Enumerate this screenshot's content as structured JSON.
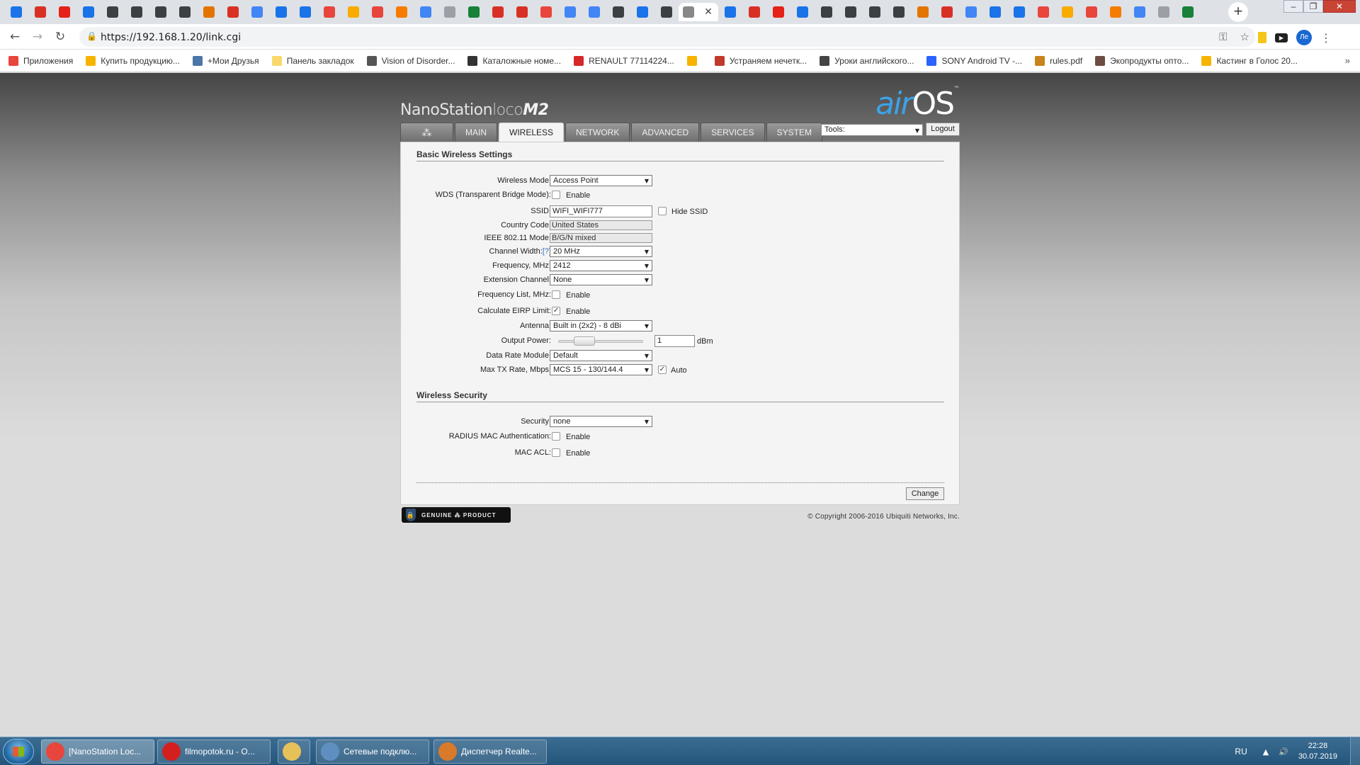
{
  "browser": {
    "url": "https://192.168.1.20/link.cgi",
    "new_tab": "+",
    "close_tab": "✕",
    "avatar": "Ле",
    "window_controls": [
      "–",
      "❐",
      "✕"
    ]
  },
  "bookmarks": [
    {
      "label": "Приложения",
      "color": "#e8453c"
    },
    {
      "label": "Купить продукцию...",
      "color": "#f6b400"
    },
    {
      "label": "+Мои Друзья",
      "color": "#4a76a8"
    },
    {
      "label": "Панель закладок",
      "color": "#f9d86b"
    },
    {
      "label": "Vision of Disorder...",
      "color": "#555555"
    },
    {
      "label": "Каталожные номе...",
      "color": "#333333"
    },
    {
      "label": "RENAULT 77114224...",
      "color": "#d62828"
    },
    {
      "label": "",
      "color": "#f6b400"
    },
    {
      "label": "Устраняем нечетк...",
      "color": "#c0392b"
    },
    {
      "label": "Уроки английского...",
      "color": "#444444"
    },
    {
      "label": "SONY Android TV -...",
      "color": "#2962ff"
    },
    {
      "label": "rules.pdf",
      "color": "#c8831a"
    },
    {
      "label": "Экопродукты опто...",
      "color": "#6d4c41"
    },
    {
      "label": "Кастинг в Голос 20...",
      "color": "#f6b400"
    }
  ],
  "airos": {
    "brand_main": "NanoStation",
    "brand_loco": "loco",
    "brand_model": "M2",
    "logo_air": "air",
    "logo_os": "OS",
    "logo_tm": "™",
    "tabs": {
      "logo": "⁂",
      "main": "MAIN",
      "wireless": "WIRELESS",
      "network": "NETWORK",
      "advanced": "ADVANCED",
      "services": "SERVICES",
      "system": "SYSTEM"
    },
    "tools": "Tools:",
    "logout": "Logout",
    "basic_title": "Basic Wireless Settings",
    "security_title": "Wireless Security",
    "enable": "Enable",
    "fields": {
      "wireless_mode": {
        "label": "Wireless Mode:",
        "value": "Access Point"
      },
      "wds": {
        "label": "WDS (Transparent Bridge Mode):"
      },
      "ssid": {
        "label": "SSID:",
        "value": "WIFI_WIFI777",
        "hide": "Hide SSID"
      },
      "country": {
        "label": "Country Code:",
        "value": "United States"
      },
      "ieee": {
        "label": "IEEE 802.11 Mode:",
        "value": "B/G/N mixed"
      },
      "channel_width": {
        "label": "Channel Width:",
        "help": "[?]",
        "value": "20 MHz"
      },
      "frequency": {
        "label": "Frequency, MHz:",
        "value": "2412"
      },
      "extension": {
        "label": "Extension Channel:",
        "value": "None"
      },
      "freq_list": {
        "label": "Frequency List, MHz:"
      },
      "eirp": {
        "label": "Calculate EIRP Limit:"
      },
      "antenna": {
        "label": "Antenna:",
        "value": "Built in (2x2) - 8 dBi"
      },
      "output_power": {
        "label": "Output Power:",
        "value": "1",
        "unit": "dBm"
      },
      "data_rate": {
        "label": "Data Rate Module:",
        "value": "Default"
      },
      "max_tx": {
        "label": "Max TX Rate, Mbps:",
        "value": "MCS 15 - 130/144.4",
        "auto": "Auto"
      },
      "security": {
        "label": "Security:",
        "value": "none"
      },
      "radius": {
        "label": "RADIUS MAC Authentication:"
      },
      "mac_acl": {
        "label": "MAC ACL:"
      }
    },
    "check": "✓",
    "change": "Change",
    "genuine": "GENUINE ⁂ PRODUCT",
    "genuine_lock": "🔒",
    "copyright": "© Copyright 2006-2016 Ubiquiti Networks, Inc."
  },
  "taskbar": {
    "items": [
      {
        "label": "[NanoStation Loc...",
        "color": "#e8453c"
      },
      {
        "label": "filmopotok.ru - O...",
        "color": "#d41f1f"
      },
      {
        "label": "",
        "color": "#e6c15a"
      },
      {
        "label": "Сетевые подклю...",
        "color": "#5f8fc1"
      },
      {
        "label": "Диспетчер Realte...",
        "color": "#d97a2b"
      }
    ],
    "lang": "RU",
    "time": "22:28",
    "date": "30.07.2019"
  }
}
